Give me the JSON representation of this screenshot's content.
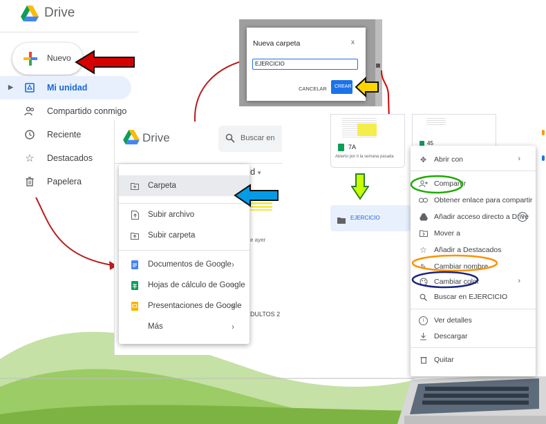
{
  "left_panel": {
    "app_name": "Drive",
    "new_button": "Nuevo",
    "nav": [
      {
        "label": "Mi unidad"
      },
      {
        "label": "Compartido conmigo"
      },
      {
        "label": "Reciente"
      },
      {
        "label": "Destacados"
      },
      {
        "label": "Papelera"
      }
    ]
  },
  "dialog": {
    "title": "Nueva carpeta",
    "close": "x",
    "input_value": "EJERCICIO",
    "cancel": "CANCELAR",
    "create": "CREAR"
  },
  "middle_panel": {
    "app_name": "Drive",
    "search_placeholder": "Buscar en",
    "partial_header": "d",
    "partial_yesterday": "e ayer",
    "partial_adults": "DULTOS 2",
    "menu": [
      {
        "label": "Carpeta"
      },
      {
        "label": "Subir archivo"
      },
      {
        "label": "Subir carpeta"
      },
      {
        "label": "Documentos de Google"
      },
      {
        "label": "Hojas de cálculo de Google"
      },
      {
        "label": "Presentaciones de Google"
      },
      {
        "label": "Más"
      }
    ]
  },
  "right_panel": {
    "file_name": "7A",
    "file_subtitle": "Abierto por ti la semana pasada",
    "partial_file": "45",
    "folder_name": "EJERCICIO",
    "context_menu": [
      {
        "label": "Abrir con"
      },
      {
        "label": "Compartir"
      },
      {
        "label": "Obtener enlace para compartir"
      },
      {
        "label": "Añadir acceso directo a Drive"
      },
      {
        "label": "Mover a"
      },
      {
        "label": "Añadir a Destacados"
      },
      {
        "label": "Cambiar nombre"
      },
      {
        "label": "Cambiar color"
      },
      {
        "label": "Buscar en EJERCICIO"
      },
      {
        "label": "Ver detalles"
      },
      {
        "label": "Descargar"
      },
      {
        "label": "Quitar"
      }
    ]
  },
  "colors": {
    "drive_blue": "#1a73e8",
    "arrow_red": "#d50000",
    "arrow_blue": "#039be5",
    "arrow_yellow": "#ffd600",
    "highlight_green": "#1faa00",
    "highlight_orange": "#ff8f00",
    "highlight_navy": "#1a237e",
    "wave_green": "#7cb342"
  }
}
